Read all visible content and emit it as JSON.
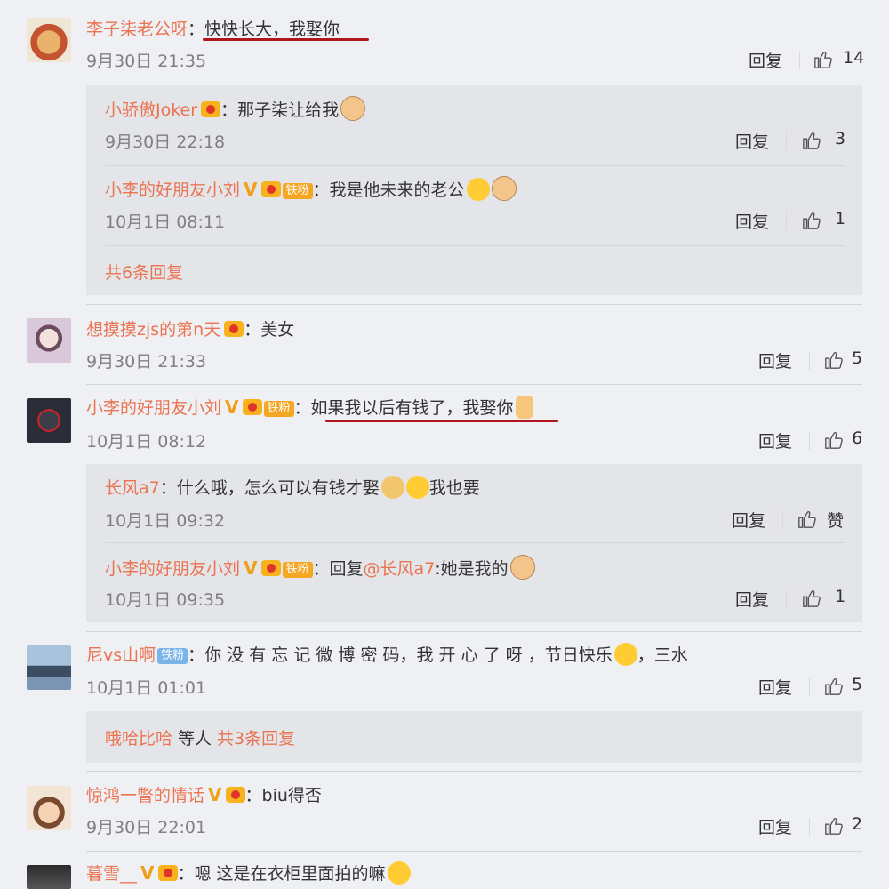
{
  "colors": {
    "name": "#eb7350",
    "underline": "#b0161c",
    "background": "#eef0f4",
    "reply_bg": "#e3e5e9"
  },
  "comments": [
    {
      "user": "李子柒老公呀",
      "text": "快快长大，我娶你",
      "time": "9月30日 21:35",
      "reply_label": "回复",
      "likes": "14",
      "replies": [
        {
          "user": "小骄傲Joker",
          "text": "那子柒让给我",
          "time": "9月30日 22:18",
          "reply_label": "回复",
          "likes": "3"
        },
        {
          "user": "小李的好朋友小刘",
          "fan_badge": "铁粉",
          "text": "我是他未来的老公",
          "time": "10月1日 08:11",
          "reply_label": "回复",
          "likes": "1"
        }
      ],
      "more": "共6条回复"
    },
    {
      "user": "想摸摸zjs的第n天",
      "text": "美女",
      "time": "9月30日 21:33",
      "reply_label": "回复",
      "likes": "5"
    },
    {
      "user": "小李的好朋友小刘",
      "fan_badge": "铁粉",
      "text": "如果我以后有钱了，我娶你",
      "time": "10月1日 08:12",
      "reply_label": "回复",
      "likes": "6",
      "replies": [
        {
          "user": "长风a7",
          "text": "什么哦，怎么可以有钱才娶",
          "text_after": "我也要",
          "time": "10月1日 09:32",
          "reply_label": "回复",
          "likes": "赞"
        },
        {
          "user": "小李的好朋友小刘",
          "fan_badge": "铁粉",
          "text_prefix": "回复",
          "mention": "@长风a7",
          "text": ":她是我的",
          "time": "10月1日 09:35",
          "reply_label": "回复",
          "likes": "1"
        }
      ]
    },
    {
      "user": "尼vs山啊",
      "fan_badge": "铁粉",
      "text": "你 没 有 忘 记 微 博 密 码，我 开 心 了 呀 ，节日快乐",
      "text_after": "，三水",
      "time": "10月1日 01:01",
      "reply_label": "回复",
      "likes": "5",
      "more_user": "哦哈比哈",
      "more_mid": "等人",
      "more": "共3条回复"
    },
    {
      "user": "惊鸿一瞥的情话",
      "text": "biu得否",
      "time": "9月30日 22:01",
      "reply_label": "回复",
      "likes": "2"
    },
    {
      "user": "暮雪__",
      "text": "嗯 这是在衣柜里面拍的嘛"
    }
  ]
}
